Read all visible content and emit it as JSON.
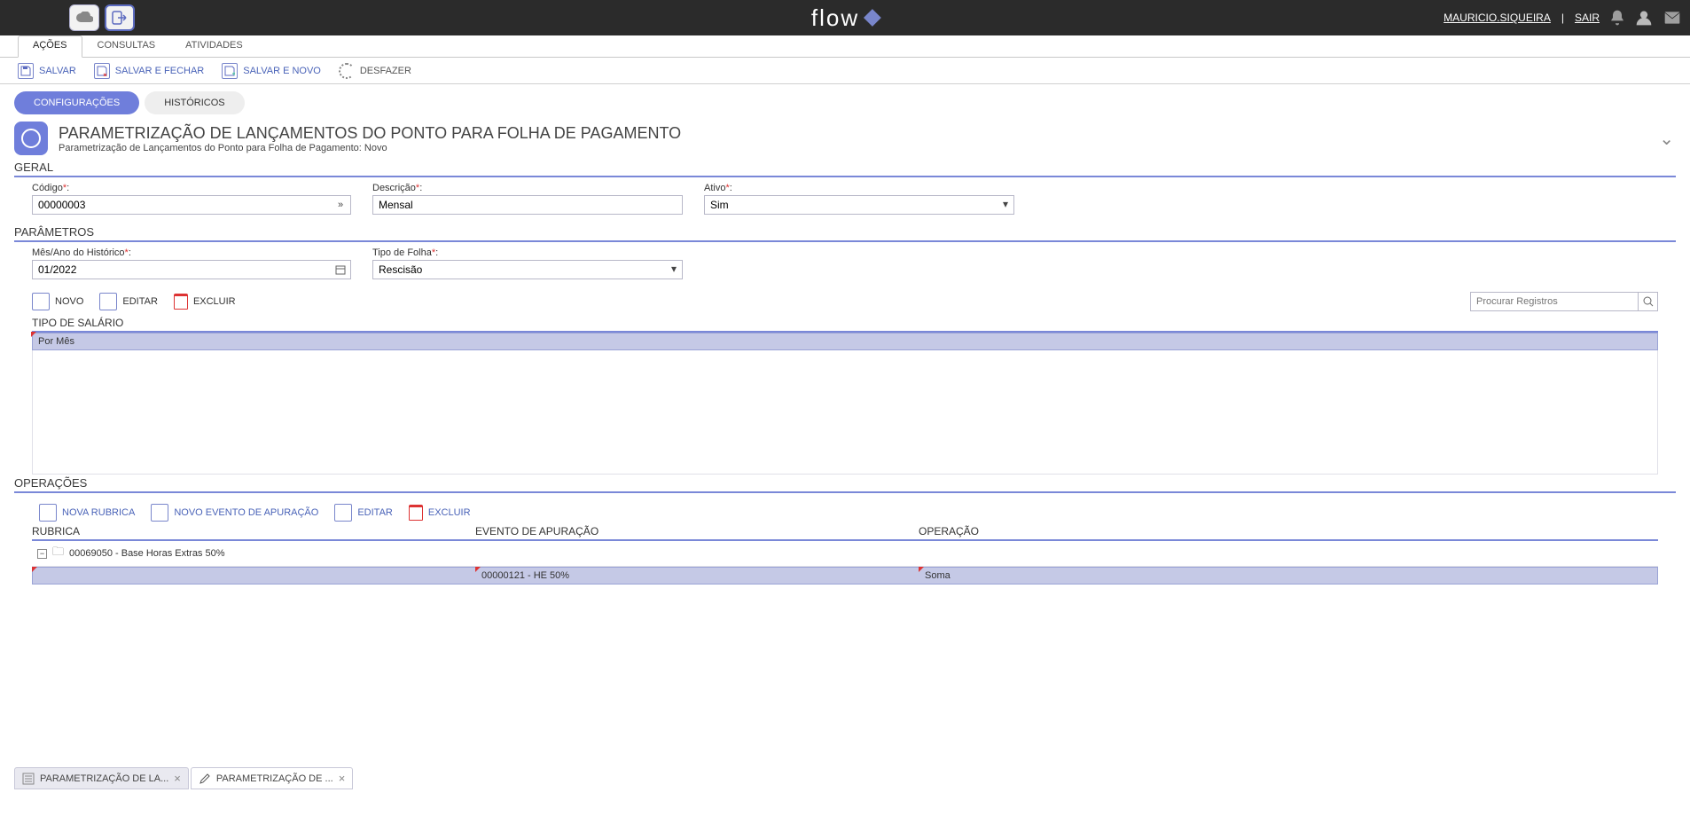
{
  "header": {
    "logo_text": "flow",
    "user_name": "MAURICIO.SIQUEIRA",
    "logout_label": "SAIR"
  },
  "main_tabs": [
    {
      "label": "AÇÕES",
      "active": true
    },
    {
      "label": "CONSULTAS",
      "active": false
    },
    {
      "label": "ATIVIDADES",
      "active": false
    }
  ],
  "toolbar": {
    "salvar": "SALVAR",
    "salvar_fechar": "SALVAR E FECHAR",
    "salvar_novo": "SALVAR E NOVO",
    "desfazer": "DESFAZER"
  },
  "pills": {
    "config": "CONFIGURAÇÕES",
    "hist": "HISTÓRICOS"
  },
  "page": {
    "title": "PARAMETRIZAÇÃO DE LANÇAMENTOS DO PONTO PARA FOLHA DE PAGAMENTO",
    "subtitle": "Parametrização de Lançamentos do Ponto para Folha de Pagamento: Novo"
  },
  "sections": {
    "geral": "GERAL",
    "parametros": "PARÂMETROS",
    "operacoes": "OPERAÇÕES"
  },
  "fields": {
    "codigo_label": "Código",
    "codigo_value": "00000003",
    "descricao_label": "Descrição",
    "descricao_value": "Mensal",
    "ativo_label": "Ativo",
    "ativo_value": "Sim",
    "mesano_label": "Mês/Ano do Histórico",
    "mesano_value": "01/2022",
    "tipofolha_label": "Tipo de Folha",
    "tipofolha_value": "Rescisão"
  },
  "grid_toolbar": {
    "novo": "NOVO",
    "editar": "EDITAR",
    "excluir": "EXCLUIR",
    "search_placeholder": "Procurar Registros"
  },
  "salario_grid": {
    "header": "TIPO DE SALÁRIO",
    "row": "Por Mês"
  },
  "op_toolbar": {
    "nova_rubrica": "NOVA RUBRICA",
    "novo_evento": "NOVO EVENTO DE APURAÇÃO",
    "editar": "EDITAR",
    "excluir": "EXCLUIR"
  },
  "op_grid": {
    "col_rubrica": "RUBRICA",
    "col_evento": "EVENTO DE APURAÇÃO",
    "col_op": "OPERAÇÃO",
    "group_row": "00069050 - Base Horas Extras 50%",
    "leaf_evento": "00000121 - HE 50%",
    "leaf_op": "Soma"
  },
  "ws_tabs": [
    {
      "label": "PARAMETRIZAÇÃO DE LA...",
      "active": false,
      "icon": "list"
    },
    {
      "label": "PARAMETRIZAÇÃO DE ...",
      "active": true,
      "icon": "edit"
    }
  ]
}
